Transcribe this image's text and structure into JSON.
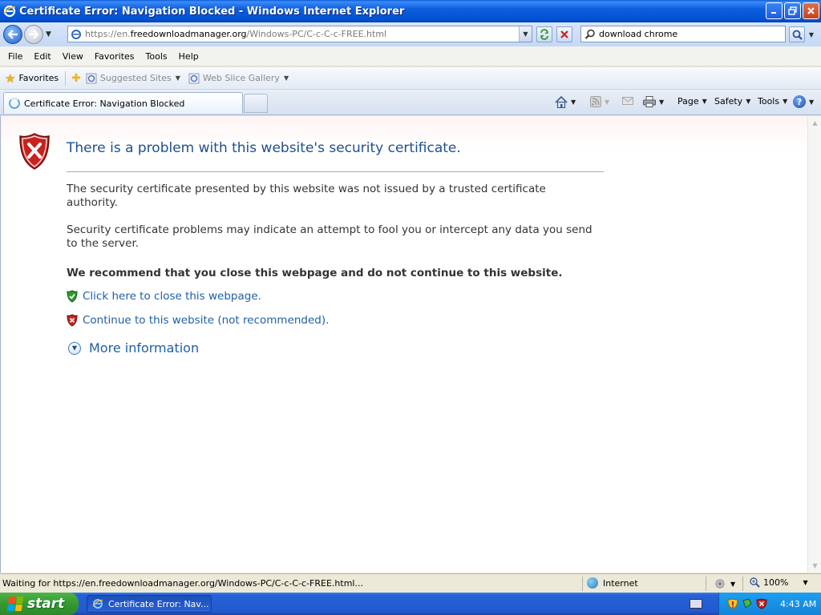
{
  "window": {
    "title": "Certificate Error: Navigation Blocked - Windows Internet Explorer"
  },
  "address": {
    "url_prefix": "https://en.",
    "url_host": "freedownloadmanager.org",
    "url_path": "/Windows-PC/C-c-C-c-FREE.html"
  },
  "search": {
    "value": "download chrome"
  },
  "menu": [
    "File",
    "Edit",
    "View",
    "Favorites",
    "Tools",
    "Help"
  ],
  "favorites_bar": {
    "favorites_label": "Favorites",
    "links": [
      "Suggested Sites",
      "Web Slice Gallery"
    ]
  },
  "tab": {
    "label": "Certificate Error: Navigation Blocked"
  },
  "commands": {
    "page": "Page",
    "safety": "Safety",
    "tools": "Tools"
  },
  "content": {
    "title": "There is a problem with this website's security certificate.",
    "para1": "The security certificate presented by this website was not issued by a trusted certificate authority.",
    "para2": "Security certificate problems may indicate an attempt to fool you or intercept any data you send to the server.",
    "recommend": "We recommend that you close this webpage and do not continue to this website.",
    "close_link": "Click here to close this webpage.",
    "continue_link": "Continue to this website (not recommended).",
    "more_info": "More information"
  },
  "status": {
    "text": "Waiting for https://en.freedownloadmanager.org/Windows-PC/C-c-C-c-FREE.html...",
    "zone": "Internet",
    "zoom": "100%"
  },
  "taskbar": {
    "start": "start",
    "item": "Certificate Error: Nav...",
    "clock": "4:43 AM"
  },
  "colors": {
    "link": "#1f5fa8",
    "title": "#1f4f8c",
    "xp_blue": "#0b5fe0",
    "start_green": "#35992f"
  }
}
